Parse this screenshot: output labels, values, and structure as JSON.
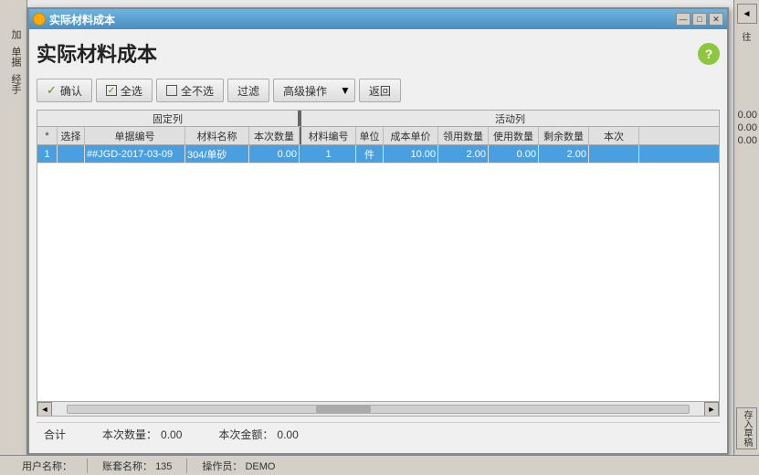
{
  "window": {
    "title": "实际材料成本",
    "page_title": "实际材料成本",
    "help_icon": "?"
  },
  "title_controls": {
    "minimize": "—",
    "maximize": "□",
    "close": "✕"
  },
  "toolbar": {
    "confirm_label": "确认",
    "select_all_label": "全选",
    "deselect_all_label": "全不选",
    "filter_label": "过滤",
    "advanced_label": "高级操作",
    "return_label": "返回"
  },
  "col_groups": {
    "fixed_label": "固定列",
    "active_label": "活动列"
  },
  "table": {
    "headers": [
      {
        "key": "row_num",
        "label": "*",
        "width_class": "w-row"
      },
      {
        "key": "select",
        "label": "选择",
        "width_class": "w-sel"
      },
      {
        "key": "doc_no",
        "label": "单据编号",
        "width_class": "w-docno"
      },
      {
        "key": "mat_name",
        "label": "材料名称",
        "width_class": "w-matname"
      },
      {
        "key": "this_qty",
        "label": "本次数量",
        "width_class": "w-qty"
      },
      {
        "key": "mat_code",
        "label": "材料编号",
        "width_class": "w-matcode"
      },
      {
        "key": "unit",
        "label": "单位",
        "width_class": "w-unit"
      },
      {
        "key": "cost_unit",
        "label": "成本单价",
        "width_class": "w-cost"
      },
      {
        "key": "recv_qty",
        "label": "领用数量",
        "width_class": "w-recvqty"
      },
      {
        "key": "use_qty",
        "label": "使用数量",
        "width_class": "w-useqty"
      },
      {
        "key": "rem_qty",
        "label": "剩余数量",
        "width_class": "w-remqty"
      },
      {
        "key": "this_amt",
        "label": "本次",
        "width_class": "w-thisamt"
      }
    ],
    "rows": [
      {
        "row_num": "1",
        "select": "",
        "doc_no": "##JGD-2017-03-09",
        "mat_name": "304/单砂",
        "this_qty": "0.00",
        "mat_code": "1",
        "unit": "件",
        "cost_unit": "10.00",
        "recv_qty": "2.00",
        "use_qty": "0.00",
        "rem_qty": "2.00",
        "this_amt": "",
        "selected": true
      }
    ]
  },
  "footer": {
    "total_label": "合计",
    "this_qty_label": "本次数量：",
    "this_qty_value": "0.00",
    "this_amt_label": "本次金额：",
    "this_amt_value": "0.00"
  },
  "status_bar": {
    "username_label": "用户名称：",
    "account_label": "账套名称：",
    "account_value": "135",
    "operator_label": "操作员：",
    "operator_value": "DEMO"
  },
  "right_sidebar": {
    "nav_arrow": "◄",
    "top_label": "往",
    "values": [
      "0.00",
      "0.00",
      "0.00"
    ],
    "bottom_label": "存入草稿"
  },
  "left_sidebar": {
    "labels": [
      "加",
      "单据",
      "经手"
    ]
  }
}
